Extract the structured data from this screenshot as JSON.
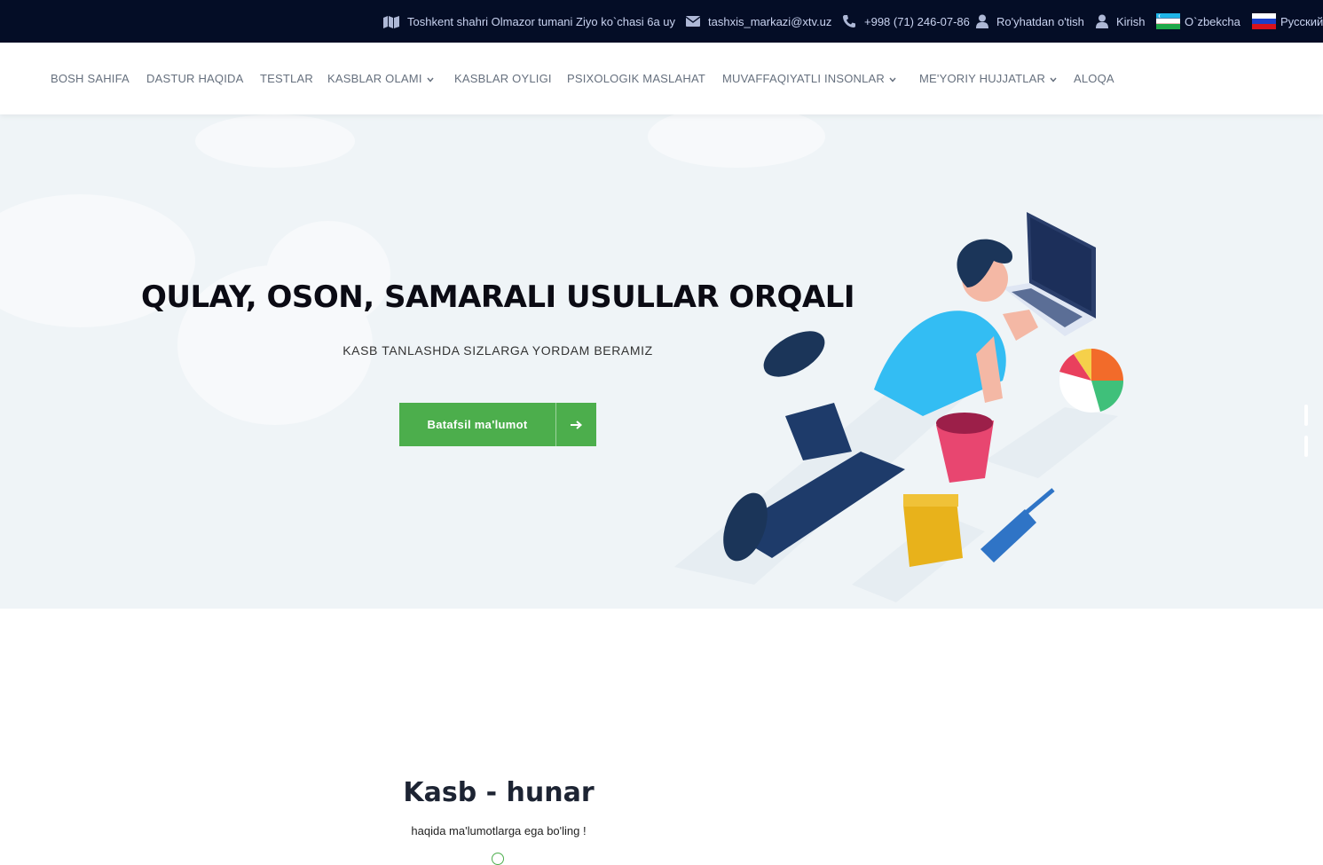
{
  "topbar": {
    "address": "Toshkent shahri Olmazor tumani Ziyo ko`chasi 6a uy",
    "email": "tashxis_markazi@xtv.uz",
    "phone": "+998 (71) 246-07-86",
    "register": "Ro'yhatdan o'tish",
    "login": "Kirish",
    "lang_uz": "O`zbekcha",
    "lang_ru": "Русский",
    "icons": {
      "address": "map-icon",
      "email": "envelope-icon",
      "phone": "phone-icon",
      "register": "user-icon",
      "login": "user-icon",
      "lang_uz": "uzbekistan-flag-icon",
      "lang_ru": "russia-flag-icon"
    }
  },
  "nav": {
    "items": [
      {
        "label": "BOSH SAHIFA",
        "dropdown": false
      },
      {
        "label": "DASTUR HAQIDA",
        "dropdown": false
      },
      {
        "label": "TESTLAR",
        "dropdown": false
      },
      {
        "label": "KASBLAR OLAMI",
        "dropdown": true
      },
      {
        "label": "KASBLAR OYLIGI",
        "dropdown": false
      },
      {
        "label": "PSIXOLOGIK MASLAHAT",
        "dropdown": false
      },
      {
        "label": "MUVAFFAQIYATLI INSONLAR",
        "dropdown": true
      },
      {
        "label": "ME'YORIY HUJJATLAR",
        "dropdown": true
      },
      {
        "label": "ALOQA",
        "dropdown": false
      }
    ]
  },
  "hero": {
    "title": "QULAY, OSON, SAMARALI USULLAR ORQALI",
    "subtitle": "KASB TANLASHDA SIZLARGA YORDAM BERAMIZ",
    "button_label": "Batafsil ma'lumot",
    "button_icon": "arrow-right-icon"
  },
  "section": {
    "title": "Kasb - hunar",
    "subtitle": "haqida ma'lumotlarga ega bo'ling !"
  },
  "colors": {
    "topbar_bg": "#040d26",
    "accent_green": "#4cae4c",
    "hero_bg": "#eff4f7",
    "nav_text": "#66707e"
  }
}
